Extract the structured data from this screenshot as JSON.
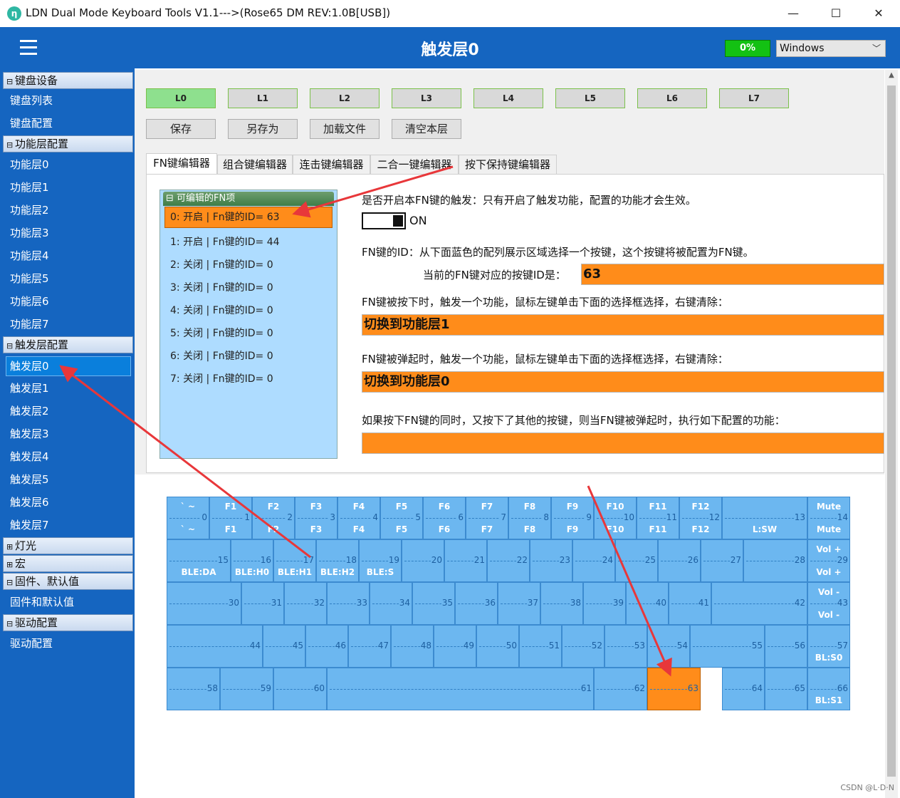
{
  "window": {
    "title": "LDN Dual Mode Keyboard Tools V1.1--->(Rose65 DM REV:1.0B[USB])",
    "minimize": "—",
    "maximize": "☐",
    "close": "✕"
  },
  "header": {
    "title": "触发层0",
    "progress": "0%",
    "os_select": "Windows"
  },
  "sidebar": {
    "groups": [
      {
        "label": "键盘设备",
        "expanded": true,
        "items": [
          "键盘列表",
          "键盘配置"
        ]
      },
      {
        "label": "功能层配置",
        "expanded": true,
        "items": [
          "功能层0",
          "功能层1",
          "功能层2",
          "功能层3",
          "功能层4",
          "功能层5",
          "功能层6",
          "功能层7"
        ]
      },
      {
        "label": "触发层配置",
        "expanded": true,
        "items": [
          "触发层0",
          "触发层1",
          "触发层2",
          "触发层3",
          "触发层4",
          "触发层5",
          "触发层6",
          "触发层7"
        ]
      },
      {
        "label": "灯光",
        "expanded": false,
        "items": []
      },
      {
        "label": "宏",
        "expanded": false,
        "items": []
      },
      {
        "label": "固件、默认值",
        "expanded": true,
        "items": [
          "固件和默认值"
        ]
      },
      {
        "label": "驱动配置",
        "expanded": true,
        "items": [
          "驱动配置"
        ]
      }
    ],
    "selected": "触发层0"
  },
  "layers": [
    "L0",
    "L1",
    "L2",
    "L3",
    "L4",
    "L5",
    "L6",
    "L7"
  ],
  "actions": [
    "保存",
    "另存为",
    "加载文件",
    "清空本层"
  ],
  "tabs": [
    "FN键编辑器",
    "组合键编辑器",
    "连击键编辑器",
    "二合一键编辑器",
    "按下保持键编辑器"
  ],
  "fn_list": {
    "title": "可编辑的FN项",
    "items": [
      "0: 开启 | Fn键的ID= 63",
      "1: 开启 | Fn键的ID= 44",
      "2: 关闭 | Fn键的ID= 0",
      "3: 关闭 | Fn键的ID= 0",
      "4: 关闭 | Fn键的ID= 0",
      "5: 关闭 | Fn键的ID= 0",
      "6: 关闭 | Fn键的ID= 0",
      "7: 关闭 | Fn键的ID= 0"
    ]
  },
  "fn_editor": {
    "enable_desc": "是否开启本FN键的触发：只有开启了触发功能，配置的功能才会生效。",
    "toggle_label": "ON",
    "id_desc": "FN键的ID：从下面蓝色的配列展示区域选择一个按键，这个按键将被配置为FN键。",
    "current_id_label": "当前的FN键对应的按键ID是：",
    "current_id_value": "63",
    "press_desc": "FN键被按下时，触发一个功能，鼠标左键单击下面的选择框选择，右键清除：",
    "press_value": "切换到功能层1",
    "release_desc": "FN键被弹起时，触发一个功能，鼠标左键单击下面的选择框选择，右键清除：",
    "release_value": "切换到功能层0",
    "combo_desc": "如果按下FN键的同时，又按下了其他的按键，则当FN键被弹起时，执行如下配置的功能：",
    "combo_value": ""
  },
  "keyboard": {
    "keys": [
      {
        "id": 0,
        "top": "` ~",
        "bot": "` ~"
      },
      {
        "id": 1,
        "top": "F1",
        "bot": "F1"
      },
      {
        "id": 2,
        "top": "F2",
        "bot": "F2"
      },
      {
        "id": 3,
        "top": "F3",
        "bot": "F3"
      },
      {
        "id": 4,
        "top": "F4",
        "bot": "F4"
      },
      {
        "id": 5,
        "top": "F5",
        "bot": "F5"
      },
      {
        "id": 6,
        "top": "F6",
        "bot": "F6"
      },
      {
        "id": 7,
        "top": "F7",
        "bot": "F7"
      },
      {
        "id": 8,
        "top": "F8",
        "bot": "F8"
      },
      {
        "id": 9,
        "top": "F9",
        "bot": "F9"
      },
      {
        "id": 10,
        "top": "F10",
        "bot": "F10"
      },
      {
        "id": 11,
        "top": "F11",
        "bot": "F11"
      },
      {
        "id": 12,
        "top": "F12",
        "bot": "F12"
      },
      {
        "id": 13,
        "top": "",
        "bot": "L:SW"
      },
      {
        "id": 14,
        "top": "Mute",
        "bot": "Mute"
      },
      {
        "id": 15,
        "top": "",
        "bot": "BLE:DA"
      },
      {
        "id": 16,
        "top": "",
        "bot": "BLE:H0"
      },
      {
        "id": 17,
        "top": "",
        "bot": "BLE:H1"
      },
      {
        "id": 18,
        "top": "",
        "bot": "BLE:H2"
      },
      {
        "id": 19,
        "top": "",
        "bot": "BLE:S"
      },
      {
        "id": 20,
        "top": "",
        "bot": ""
      },
      {
        "id": 21,
        "top": "",
        "bot": ""
      },
      {
        "id": 22,
        "top": "",
        "bot": ""
      },
      {
        "id": 23,
        "top": "",
        "bot": ""
      },
      {
        "id": 24,
        "top": "",
        "bot": ""
      },
      {
        "id": 25,
        "top": "",
        "bot": ""
      },
      {
        "id": 26,
        "top": "",
        "bot": ""
      },
      {
        "id": 27,
        "top": "",
        "bot": ""
      },
      {
        "id": 28,
        "top": "",
        "bot": ""
      },
      {
        "id": 29,
        "top": "Vol +",
        "bot": "Vol +"
      },
      {
        "id": 30,
        "top": "",
        "bot": ""
      },
      {
        "id": 31,
        "top": "",
        "bot": ""
      },
      {
        "id": 32,
        "top": "",
        "bot": ""
      },
      {
        "id": 33,
        "top": "",
        "bot": ""
      },
      {
        "id": 34,
        "top": "",
        "bot": ""
      },
      {
        "id": 35,
        "top": "",
        "bot": ""
      },
      {
        "id": 36,
        "top": "",
        "bot": ""
      },
      {
        "id": 37,
        "top": "",
        "bot": ""
      },
      {
        "id": 38,
        "top": "",
        "bot": ""
      },
      {
        "id": 39,
        "top": "",
        "bot": ""
      },
      {
        "id": 40,
        "top": "",
        "bot": ""
      },
      {
        "id": 41,
        "top": "",
        "bot": ""
      },
      {
        "id": 42,
        "top": "",
        "bot": ""
      },
      {
        "id": 43,
        "top": "Vol -",
        "bot": "Vol -"
      },
      {
        "id": 44,
        "top": "",
        "bot": ""
      },
      {
        "id": 45,
        "top": "",
        "bot": ""
      },
      {
        "id": 46,
        "top": "",
        "bot": ""
      },
      {
        "id": 47,
        "top": "",
        "bot": ""
      },
      {
        "id": 48,
        "top": "",
        "bot": ""
      },
      {
        "id": 49,
        "top": "",
        "bot": ""
      },
      {
        "id": 50,
        "top": "",
        "bot": ""
      },
      {
        "id": 51,
        "top": "",
        "bot": ""
      },
      {
        "id": 52,
        "top": "",
        "bot": ""
      },
      {
        "id": 53,
        "top": "",
        "bot": ""
      },
      {
        "id": 54,
        "top": "",
        "bot": ""
      },
      {
        "id": 55,
        "top": "",
        "bot": ""
      },
      {
        "id": 56,
        "top": "",
        "bot": ""
      },
      {
        "id": 57,
        "top": "",
        "bot": "BL:S0"
      },
      {
        "id": 58,
        "top": "",
        "bot": ""
      },
      {
        "id": 59,
        "top": "",
        "bot": ""
      },
      {
        "id": 60,
        "top": "",
        "bot": ""
      },
      {
        "id": 61,
        "top": "",
        "bot": ""
      },
      {
        "id": 62,
        "top": "",
        "bot": ""
      },
      {
        "id": 63,
        "top": "",
        "bot": ""
      },
      {
        "id": 64,
        "top": "",
        "bot": ""
      },
      {
        "id": 65,
        "top": "",
        "bot": ""
      },
      {
        "id": 66,
        "top": "",
        "bot": "BL:S1"
      }
    ],
    "selected_id": 63
  },
  "colors": {
    "header_blue": "#1565c0",
    "key_blue": "#6cb7f0",
    "fn_orange": "#ff8c1a",
    "active_layer_green": "#8ee08e",
    "progress_green": "#13c113",
    "annotation_red": "#e8373a"
  },
  "watermark": "CSDN @L·D·N"
}
